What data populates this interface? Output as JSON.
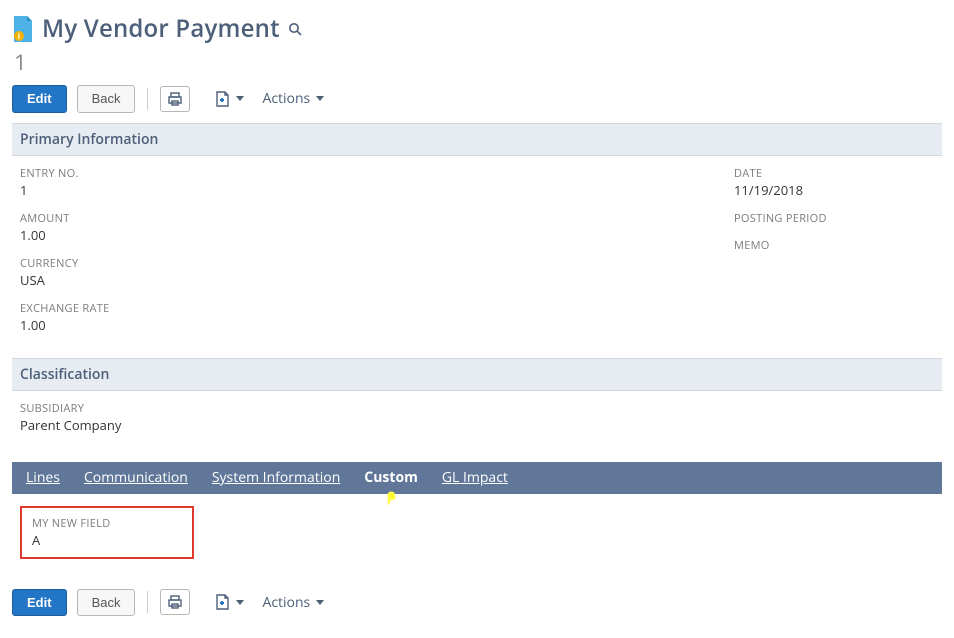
{
  "header": {
    "title": "My Vendor Payment",
    "record_no": "1"
  },
  "actions": {
    "edit": "Edit",
    "back": "Back",
    "actions_menu": "Actions"
  },
  "sections": {
    "primary": {
      "title": "Primary Information",
      "left": [
        {
          "label": "ENTRY NO.",
          "value": "1"
        },
        {
          "label": "AMOUNT",
          "value": "1.00"
        },
        {
          "label": "CURRENCY",
          "value": "USA"
        },
        {
          "label": "EXCHANGE RATE",
          "value": "1.00"
        }
      ],
      "right": [
        {
          "label": "DATE",
          "value": "11/19/2018"
        },
        {
          "label": "POSTING PERIOD",
          "value": ""
        },
        {
          "label": "MEMO",
          "value": ""
        }
      ]
    },
    "classification": {
      "title": "Classification",
      "fields": [
        {
          "label": "SUBSIDIARY",
          "value": "Parent Company"
        }
      ]
    }
  },
  "subtabs": [
    "Lines",
    "Communication",
    "System Information",
    "Custom",
    "GL Impact"
  ],
  "subtab_active": "Custom",
  "custom_tab": {
    "field_label": "MY NEW FIELD",
    "field_value": "A"
  }
}
